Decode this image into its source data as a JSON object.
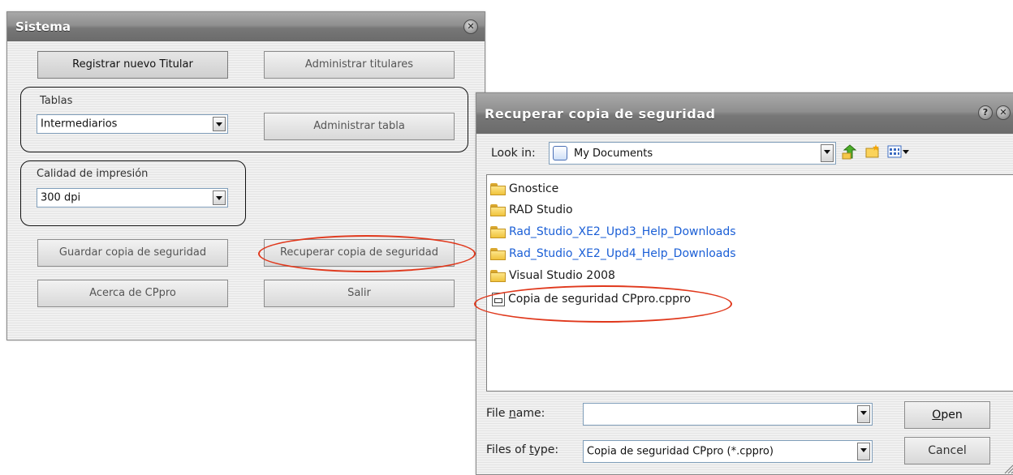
{
  "sistema": {
    "title": "Sistema",
    "buttons": {
      "registrar": "Registrar nuevo Titular",
      "administrar_titulares": "Administrar titulares",
      "administrar_tabla": "Administrar tabla",
      "guardar": "Guardar copia de seguridad",
      "recuperar": "Recuperar copia de seguridad",
      "acerca": "Acerca de CPpro",
      "salir": "Salir"
    },
    "tablas": {
      "label": "Tablas",
      "selected": "Intermediarios"
    },
    "calidad": {
      "label": "Calidad de impresión",
      "selected": "300 dpi"
    }
  },
  "dialog": {
    "title": "Recuperar copia de seguridad",
    "look_in_label": "Look in:",
    "look_in_value": "My Documents",
    "files": [
      {
        "name": "Gnostice",
        "type": "folder",
        "link": false
      },
      {
        "name": "RAD Studio",
        "type": "folder",
        "link": false
      },
      {
        "name": "Rad_Studio_XE2_Upd3_Help_Downloads",
        "type": "folder",
        "link": true
      },
      {
        "name": "Rad_Studio_XE2_Upd4_Help_Downloads",
        "type": "folder",
        "link": true
      },
      {
        "name": "Visual Studio 2008",
        "type": "folder",
        "link": false
      },
      {
        "name": "Copia de seguridad CPpro.cppro",
        "type": "file",
        "link": false
      }
    ],
    "file_name_label": "File name:",
    "file_name_value": "",
    "files_of_type_label": "Files of type:",
    "files_of_type_value": "Copia de seguridad CPpro (*.cppro)",
    "open_label": "Open",
    "cancel_label": "Cancel"
  },
  "colors": {
    "highlight": "#e0381c",
    "link": "#1b5fd6"
  }
}
